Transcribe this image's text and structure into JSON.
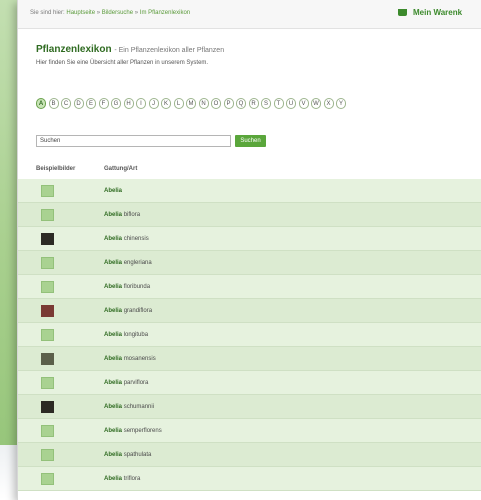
{
  "breadcrumb": {
    "prefix": "Sie sind hier:",
    "items": [
      "Hauptseite",
      "Bildersuche",
      "Im Pflanzenlexikon"
    ],
    "separator": "»"
  },
  "cart": {
    "label": "Mein Warenk"
  },
  "page": {
    "title": "Pflanzenlexikon",
    "subtitle": "- Ein Pflanzenlexikon aller Pflanzen",
    "intro": "Hier finden Sie eine Übersicht aller Pflanzen in unserem System."
  },
  "alphabet": {
    "letters": [
      "A",
      "B",
      "C",
      "D",
      "E",
      "F",
      "G",
      "H",
      "I",
      "J",
      "K",
      "L",
      "M",
      "N",
      "O",
      "P",
      "Q",
      "R",
      "S",
      "T",
      "U",
      "V",
      "W",
      "X",
      "Y"
    ],
    "active": "A"
  },
  "search": {
    "value": "Suchen",
    "button_label": "Suchen"
  },
  "table": {
    "columns": [
      "Beispielbilder",
      "Gattung/Art"
    ],
    "rows": [
      {
        "genus": "Abelia",
        "species": "",
        "thumb": "placeholder"
      },
      {
        "genus": "Abelia",
        "species": "biflora",
        "thumb": "placeholder"
      },
      {
        "genus": "Abelia",
        "species": "chinensis",
        "thumb": "photo"
      },
      {
        "genus": "Abelia",
        "species": "engleriana",
        "thumb": "placeholder"
      },
      {
        "genus": "Abelia",
        "species": "floribunda",
        "thumb": "placeholder"
      },
      {
        "genus": "Abelia",
        "species": "grandiflora",
        "thumb": "photo"
      },
      {
        "genus": "Abelia",
        "species": "longituba",
        "thumb": "placeholder"
      },
      {
        "genus": "Abelia",
        "species": "mosanensis",
        "thumb": "photo"
      },
      {
        "genus": "Abelia",
        "species": "parviflora",
        "thumb": "placeholder"
      },
      {
        "genus": "Abelia",
        "species": "schumannii",
        "thumb": "photo"
      },
      {
        "genus": "Abelia",
        "species": "semperflorens",
        "thumb": "placeholder"
      },
      {
        "genus": "Abelia",
        "species": "spathulata",
        "thumb": "placeholder"
      },
      {
        "genus": "Abelia",
        "species": "triflora",
        "thumb": "placeholder"
      }
    ]
  }
}
